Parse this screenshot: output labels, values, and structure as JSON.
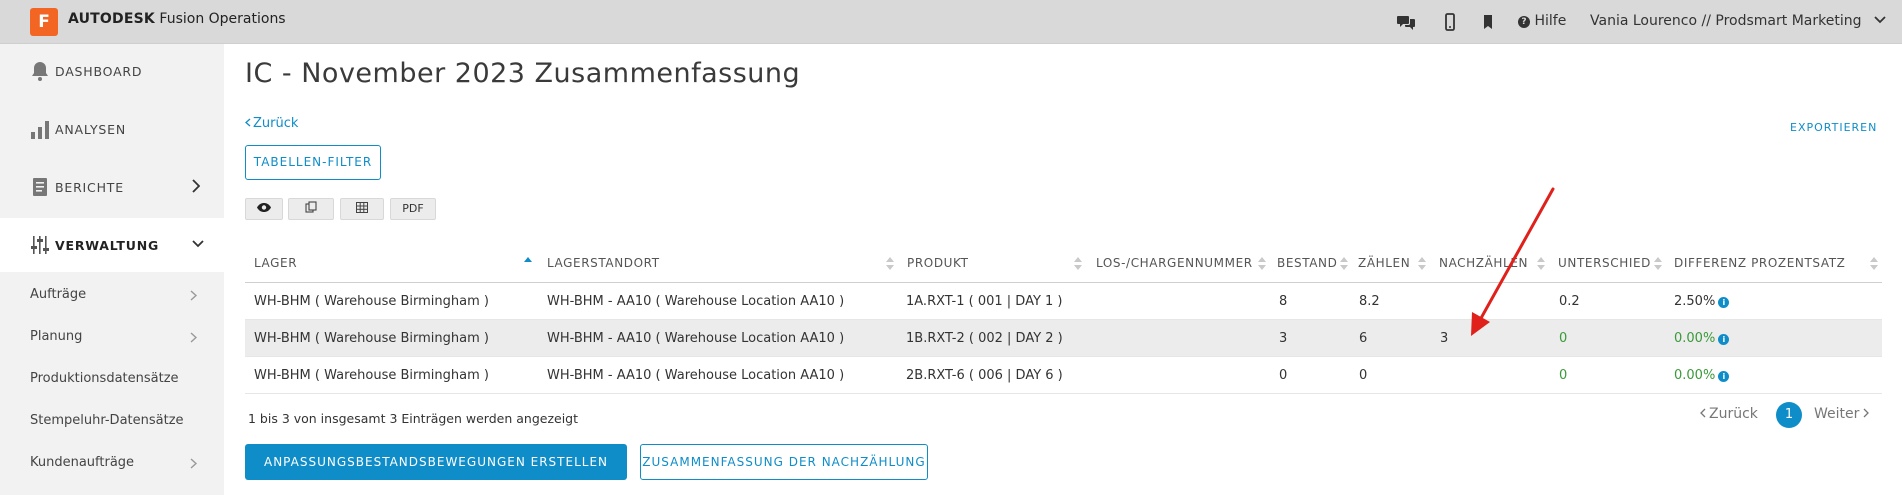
{
  "app": {
    "logo_letter": "F",
    "brand_bold": "AUTODESK",
    "brand_rest": "Fusion Operations",
    "help_label": "Hilfe",
    "user_label": "Vania Lourenco // Prodsmart Marketing",
    "icons": [
      "chat-icon",
      "mobile-icon",
      "bookmark-icon",
      "help-icon",
      "chevron-down-icon"
    ]
  },
  "sidebar": {
    "main": [
      {
        "label": "DASHBOARD",
        "icon": "bell-icon"
      },
      {
        "label": "ANALYSEN",
        "icon": "bar-chart-icon"
      },
      {
        "label": "BERICHTE",
        "icon": "report-icon"
      },
      {
        "label": "VERWALTUNG",
        "icon": "sliders-icon"
      }
    ],
    "sub": [
      {
        "label": "Aufträge"
      },
      {
        "label": "Planung"
      },
      {
        "label": "Produktionsdatensätze"
      },
      {
        "label": "Stempeluhr-Datensätze"
      },
      {
        "label": "Kundenaufträge"
      }
    ]
  },
  "main": {
    "title": "IC - November 2023 Zusammenfassung",
    "back_label": "Zurück",
    "export_label": "EXPORTIEREN",
    "filter_label": "TABELLEN-FILTER",
    "tools": [
      {
        "label": "",
        "icon": "eye-icon"
      },
      {
        "label": "",
        "icon": "copy-icon"
      },
      {
        "label": "",
        "icon": "table-icon"
      },
      {
        "label": "PDF",
        "icon": ""
      }
    ]
  },
  "table": {
    "columns": [
      "LAGER",
      "LAGERSTANDORT",
      "PRODUKT",
      "LOS-/CHARGENNUMMER",
      "BESTAND",
      "ZÄHLEN",
      "NACHZÄHLEN",
      "UNTERSCHIED",
      "DIFFERENZ PROZENTSATZ"
    ],
    "rows": [
      {
        "lager": "WH-BHM ( Warehouse Birmingham )",
        "standort": "WH-BHM - AA10 ( Warehouse Location AA10 )",
        "produkt": "1A.RXT-1 ( 001 | DAY 1 )",
        "los": "",
        "bestand": "8",
        "zaehlen": "8.2",
        "nachzaehlen": "",
        "unterschied": "0.2",
        "differenz": "2.50%"
      },
      {
        "lager": "WH-BHM ( Warehouse Birmingham )",
        "standort": "WH-BHM - AA10 ( Warehouse Location AA10 )",
        "produkt": "1B.RXT-2 ( 002 | DAY 2 )",
        "los": "",
        "bestand": "3",
        "zaehlen": "6",
        "nachzaehlen": "3",
        "unterschied": "0",
        "differenz": "0.00%"
      },
      {
        "lager": "WH-BHM ( Warehouse Birmingham )",
        "standort": "WH-BHM - AA10 ( Warehouse Location AA10 )",
        "produkt": "2B.RXT-6 ( 006 | DAY 6 )",
        "los": "",
        "bestand": "0",
        "zaehlen": "0",
        "nachzaehlen": "",
        "unterschied": "0",
        "differenz": "0.00%"
      }
    ],
    "summary": "1 bis 3 von insgesamt 3 Einträgen werden angezeigt"
  },
  "pagination": {
    "prev_label": "Zurück",
    "current_page": "1",
    "next_label": "Weiter"
  },
  "actions": {
    "primary_label": "ANPASSUNGSBESTANDSBEWEGUNGEN ERSTELLEN",
    "secondary_label": "ZUSAMMENFASSUNG DER NACHZÄHLUNG"
  },
  "colors": {
    "accent": "#0f8dc9",
    "logo": "#f26522",
    "positive": "#3a9a3a",
    "annotation_arrow": "#e0201b"
  }
}
